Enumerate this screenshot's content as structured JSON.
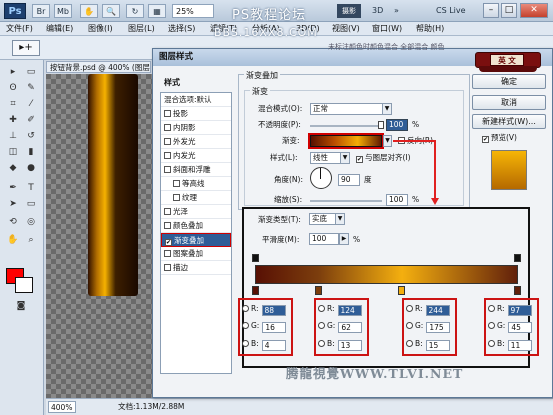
{
  "app": {
    "logo": "Ps",
    "zoom_select": "25%",
    "workspace_button": "摄影",
    "workspace_3d": "3D",
    "cs_live": "CS Live",
    "window_buttons": [
      "–",
      "□",
      "✕"
    ]
  },
  "menu": [
    "文件(F)",
    "编辑(E)",
    "图像(I)",
    "图层(L)",
    "选择(S)",
    "滤镜(T)",
    "分析(A)",
    "3D(D)",
    "视图(V)",
    "窗口(W)",
    "帮助(H)"
  ],
  "watermarks": {
    "top": "PS教程论坛",
    "top2": "BBS.16XX8.COM",
    "bottom": "腾龍視覺WWW.TLVI.NET",
    "hint": "未标注颜色时颜色混合 全部混合 颜色"
  },
  "document": {
    "tab": "按钮背景.psd @ 400% (图层...",
    "zoom": "400%",
    "size": "文档:1.13M/2.88M"
  },
  "dialog": {
    "title": "图层样式",
    "ime_label": "英 文",
    "styles_header": "样式",
    "blend_options": "混合选项:默认",
    "style_items": [
      {
        "label": "投影",
        "checked": false
      },
      {
        "label": "内阴影",
        "checked": false
      },
      {
        "label": "外发光",
        "checked": false
      },
      {
        "label": "内发光",
        "checked": false
      },
      {
        "label": "斜面和浮雕",
        "checked": false
      },
      {
        "label": "等高线",
        "checked": false
      },
      {
        "label": "纹理",
        "checked": false
      },
      {
        "label": "光泽",
        "checked": false
      },
      {
        "label": "颜色叠加",
        "checked": false
      },
      {
        "label": "渐变叠加",
        "checked": true
      },
      {
        "label": "图案叠加",
        "checked": false
      },
      {
        "label": "描边",
        "checked": false
      }
    ],
    "gradient_overlay": {
      "section_title": "渐变叠加",
      "group_title": "渐变",
      "blend_mode_label": "混合模式(O):",
      "blend_mode_value": "正常",
      "opacity_label": "不透明度(P):",
      "opacity_value": "100",
      "opacity_unit": "%",
      "gradient_label": "渐变:",
      "reverse_label": "反向(R)",
      "style_label": "样式(L):",
      "style_value": "线性",
      "align_label": "与图层对齐(I)",
      "angle_label": "角度(N):",
      "angle_value": "90",
      "angle_unit": "度",
      "scale_label": "缩放(S):",
      "scale_value": "100",
      "scale_unit": "%"
    },
    "buttons": {
      "ok": "确定",
      "cancel": "取消",
      "new_style": "新建样式(W)...",
      "preview": "预览(V)"
    },
    "gradient_editor": {
      "type_label": "渐变类型(T):",
      "type_value": "实底",
      "smoothness_label": "平滑度(M):",
      "smoothness_value": "100",
      "smoothness_unit": "%",
      "stops": [
        {
          "r": "88",
          "g": "16",
          "b": "4"
        },
        {
          "r": "124",
          "g": "62",
          "b": "13"
        },
        {
          "r": "244",
          "g": "175",
          "b": "15"
        },
        {
          "r": "97",
          "g": "45",
          "b": "11"
        }
      ]
    }
  }
}
